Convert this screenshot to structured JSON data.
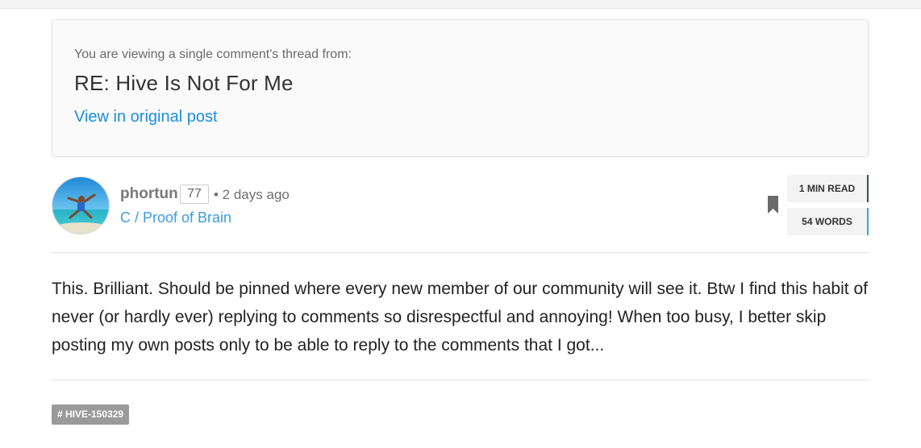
{
  "thread_context": {
    "intro": "You are viewing a single comment's thread from:",
    "title": "RE: Hive Is Not For Me",
    "link_label": "View in original post"
  },
  "author": {
    "name": "phortun",
    "reputation": "77",
    "time": "• 2 days ago",
    "community": "C / Proof of Brain"
  },
  "post_stats": {
    "read_time": "1 MIN READ",
    "word_count": "54 WORDS"
  },
  "comment": {
    "body": "This. Brilliant. Should be pinned where every new member of our community will see it. Btw I find this habit of never (or hardly ever) replying to comments so disrespectful and annoying! When too busy, I better skip posting my own posts only to be able to reply to the comments that I got..."
  },
  "tags": [
    "# HIVE-150329"
  ],
  "colors": {
    "link": "#1a8ee0",
    "community": "#3a9de0",
    "stat_read_accent": "#3f4d5a",
    "stat_words_accent": "#36a9c7",
    "tag_bg": "#9a9a9a"
  },
  "icons": {
    "bookmark": "bookmark-icon"
  }
}
